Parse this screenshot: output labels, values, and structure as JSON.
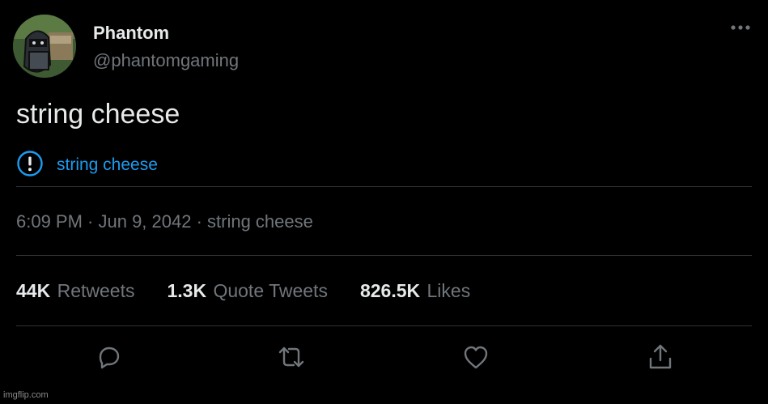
{
  "author": {
    "name": "Phantom",
    "handle": "@phantomgaming",
    "avatar_icon": "cartoon-character-avatar"
  },
  "tweet": {
    "text": "string cheese",
    "notice_text": "string cheese",
    "notice_icon": "exclamation-circle-icon",
    "timestamp": "6:09 PM · Jun 9, 2042 · string cheese"
  },
  "stats": {
    "retweets": {
      "count": "44K",
      "label": "Retweets"
    },
    "quote_tweets": {
      "count": "1.3K",
      "label": "Quote Tweets"
    },
    "likes": {
      "count": "826.5K",
      "label": "Likes"
    }
  },
  "actions": [
    "reply-icon",
    "retweet-icon",
    "like-icon",
    "share-icon"
  ],
  "watermark": "imgflip.com",
  "colors": {
    "background": "#000000",
    "primary_text": "#e7e9ea",
    "secondary_text": "#71767b",
    "accent": "#1d9bf0",
    "divider": "#2f3336"
  }
}
